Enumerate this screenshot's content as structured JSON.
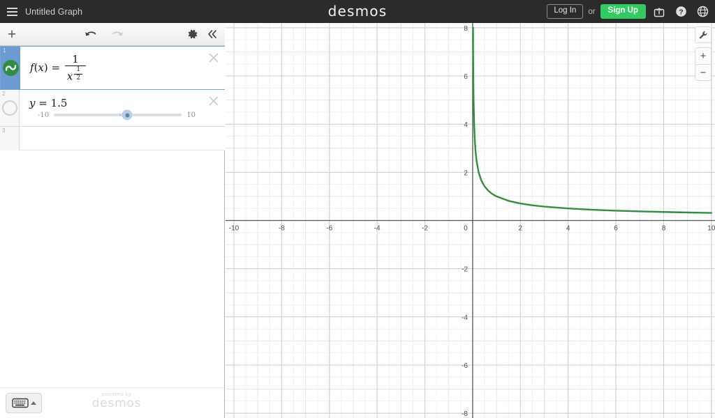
{
  "header": {
    "menu_icon": "hamburger-icon",
    "title": "Untitled Graph",
    "brand": "desmos",
    "login_label": "Log In",
    "or_label": "or",
    "signup_label": "Sign Up",
    "share_icon": "share-icon",
    "help_icon": "help-icon",
    "language_icon": "globe-icon",
    "background": "#2b2b2b",
    "signup_color": "#31cb62"
  },
  "toolbar": {
    "add_label": "+",
    "undo_icon": "undo-arrow-icon",
    "redo_icon": "redo-arrow-icon",
    "settings_icon": "gear-icon",
    "collapse_icon": "double-chevron-left-icon"
  },
  "expressions": [
    {
      "index": "1",
      "type": "function",
      "color": "#2f8f3f",
      "selected": true,
      "math": {
        "lhs_f": "f",
        "lhs_open": "(",
        "lhs_var": "x",
        "lhs_close": ")",
        "equals": "=",
        "numerator": "1",
        "den_base": "x",
        "exp_num": "1",
        "exp_den": "2"
      },
      "latex": "f(x)=\\frac{1}{x^{\\frac{1}{2}}}",
      "delete_icon": "close-icon"
    },
    {
      "index": "2",
      "type": "slider",
      "selected": false,
      "math": {
        "var": "y",
        "equals": "=",
        "value": "1.5"
      },
      "latex": "y=1.5",
      "slider": {
        "min": "-10",
        "max": "10",
        "value": 1.5,
        "percent": 57.5
      },
      "delete_icon": "close-icon"
    },
    {
      "index": "3",
      "type": "empty",
      "selected": false
    }
  ],
  "panel_bottom": {
    "keyboard_icon": "keyboard-icon",
    "caret_icon": "caret-up-icon",
    "watermark_small": "powered by",
    "watermark_big": "desmos"
  },
  "graph_tools": {
    "settings_icon": "wrench-icon",
    "zoom_in_label": "+",
    "zoom_out_label": "−"
  },
  "chart_data": {
    "type": "line",
    "title": "",
    "xlabel": "",
    "ylabel": "",
    "xlim": [
      -10.35,
      10.15
    ],
    "ylim": [
      -8.2,
      8.2
    ],
    "grid": true,
    "minor_grid": true,
    "legend": "none",
    "x_ticks": [
      -10,
      -8,
      -6,
      -4,
      -2,
      0,
      2,
      4,
      6,
      8,
      10
    ],
    "x_tick_labels": [
      "-10",
      "-8",
      "-6",
      "-4",
      "-2",
      "0",
      "2",
      "4",
      "6",
      "8",
      "10"
    ],
    "y_ticks": [
      8,
      6,
      4,
      2,
      0,
      -2,
      -4,
      -6,
      -8
    ],
    "y_tick_labels": [
      "8",
      "6",
      "4",
      "2",
      "0",
      "-2",
      "-4",
      "-6",
      "-8"
    ],
    "series": [
      {
        "name": "f(x)=1/x^(1/2)",
        "color": "#2f8f3f",
        "domain": [
          0.0,
          10.15
        ],
        "points": [
          [
            0.0156,
            8.0
          ],
          [
            0.02,
            7.07
          ],
          [
            0.025,
            6.32
          ],
          [
            0.031,
            5.68
          ],
          [
            0.04,
            5.0
          ],
          [
            0.0625,
            4.0
          ],
          [
            0.09,
            3.33
          ],
          [
            0.12,
            2.89
          ],
          [
            0.16,
            2.5
          ],
          [
            0.25,
            2.0
          ],
          [
            0.36,
            1.67
          ],
          [
            0.49,
            1.43
          ],
          [
            0.64,
            1.25
          ],
          [
            0.81,
            1.11
          ],
          [
            1.0,
            1.0
          ],
          [
            1.5,
            0.816
          ],
          [
            2.0,
            0.707
          ],
          [
            2.5,
            0.632
          ],
          [
            3.0,
            0.577
          ],
          [
            4.0,
            0.5
          ],
          [
            5.0,
            0.447
          ],
          [
            6.0,
            0.408
          ],
          [
            7.0,
            0.378
          ],
          [
            8.0,
            0.354
          ],
          [
            9.0,
            0.333
          ],
          [
            10.0,
            0.316
          ]
        ]
      }
    ]
  }
}
